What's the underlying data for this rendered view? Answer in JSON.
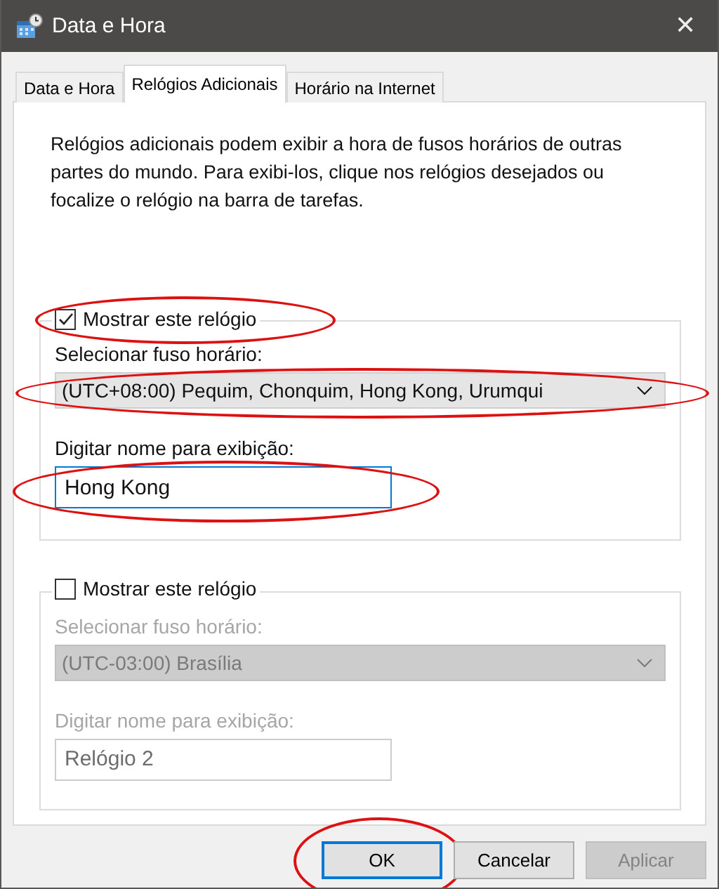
{
  "window": {
    "title": "Data e Hora",
    "close": "✕"
  },
  "tabs": [
    {
      "label": "Data e Hora",
      "selected": false
    },
    {
      "label": "Relógios Adicionais",
      "selected": true
    },
    {
      "label": "Horário na Internet",
      "selected": false
    }
  ],
  "description": "Relógios adicionais podem exibir a hora de fusos horários de outras partes do mundo. Para exibi-los, clique nos relógios desejados ou focalize o relógio na barra de tarefas.",
  "clocks": [
    {
      "show_label": "Mostrar este relógio",
      "checked": true,
      "show_highlighted": true,
      "timezone_label": "Selecionar fuso horário:",
      "timezone": "(UTC+08:00) Pequim, Chonquim, Hong Kong, Urumqui",
      "timezone_highlighted": true,
      "name_label": "Digitar nome para exibição:",
      "name_value": "Hong Kong",
      "name_highlighted": true,
      "disabled": false
    },
    {
      "show_label": "Mostrar este relógio",
      "checked": false,
      "show_highlighted": false,
      "timezone_label": "Selecionar fuso horário:",
      "timezone": "(UTC-03:00) Brasília",
      "timezone_highlighted": false,
      "name_label": "Digitar nome para exibição:",
      "name_value": "Relógio 2",
      "name_highlighted": false,
      "disabled": true
    }
  ],
  "buttons": [
    {
      "label": "OK",
      "default": true,
      "disabled": false,
      "highlighted": true
    },
    {
      "label": "Cancelar",
      "default": false,
      "disabled": false,
      "highlighted": false
    },
    {
      "label": "Aplicar",
      "default": false,
      "disabled": true,
      "highlighted": false
    }
  ]
}
